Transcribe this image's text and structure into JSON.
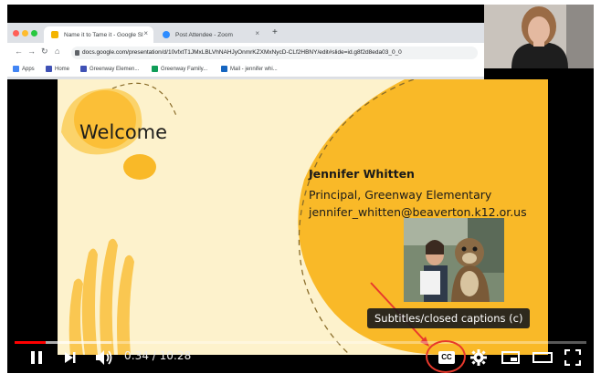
{
  "browser": {
    "tabs": [
      {
        "title": "Name it to Tame it - Google Sl",
        "active": true
      },
      {
        "title": "Post Attendee - Zoom",
        "active": false
      }
    ],
    "new_tab": "+",
    "url": "docs.google.com/presentation/d/10vfxtT1JMxLBLVhNAHJyOnmrKZXMxNycD-CLf2HBNY/edit#slide=id.g8f2d8eda03_0_0",
    "bookmarks": [
      {
        "label": "Apps",
        "icon": "apps-grid-icon",
        "color": "#4285f4"
      },
      {
        "label": "Home",
        "icon": "home-icon",
        "color": "#3f51b5"
      },
      {
        "label": "Greenway Elemen...",
        "icon": "school-icon",
        "color": "#3f51b5"
      },
      {
        "label": "Greenway Family...",
        "icon": "sheet-icon",
        "color": "#0f9d58"
      },
      {
        "label": "Mail - jennifer whi...",
        "icon": "mail-icon",
        "color": "#1565c0"
      }
    ]
  },
  "slide": {
    "title": "Welcome",
    "speaker_name": "Jennifer Whitten",
    "speaker_role": "Principal, Greenway Elementary",
    "speaker_email": "jennifer_whitten@beaverton.k12.or.us"
  },
  "player": {
    "time_display": "0:34 / 10:28",
    "progress_played": 0.054,
    "progress_loaded": 0.17,
    "tooltip": "Subtitles/closed captions (c)",
    "cc_label": "CC",
    "accent_color": "#ff0000",
    "icons": [
      "pause-icon",
      "next-icon",
      "volume-icon",
      "cc-icon",
      "settings-icon",
      "miniplayer-icon",
      "theater-icon",
      "fullscreen-icon"
    ]
  },
  "annotation": {
    "color": "#e8392c"
  }
}
